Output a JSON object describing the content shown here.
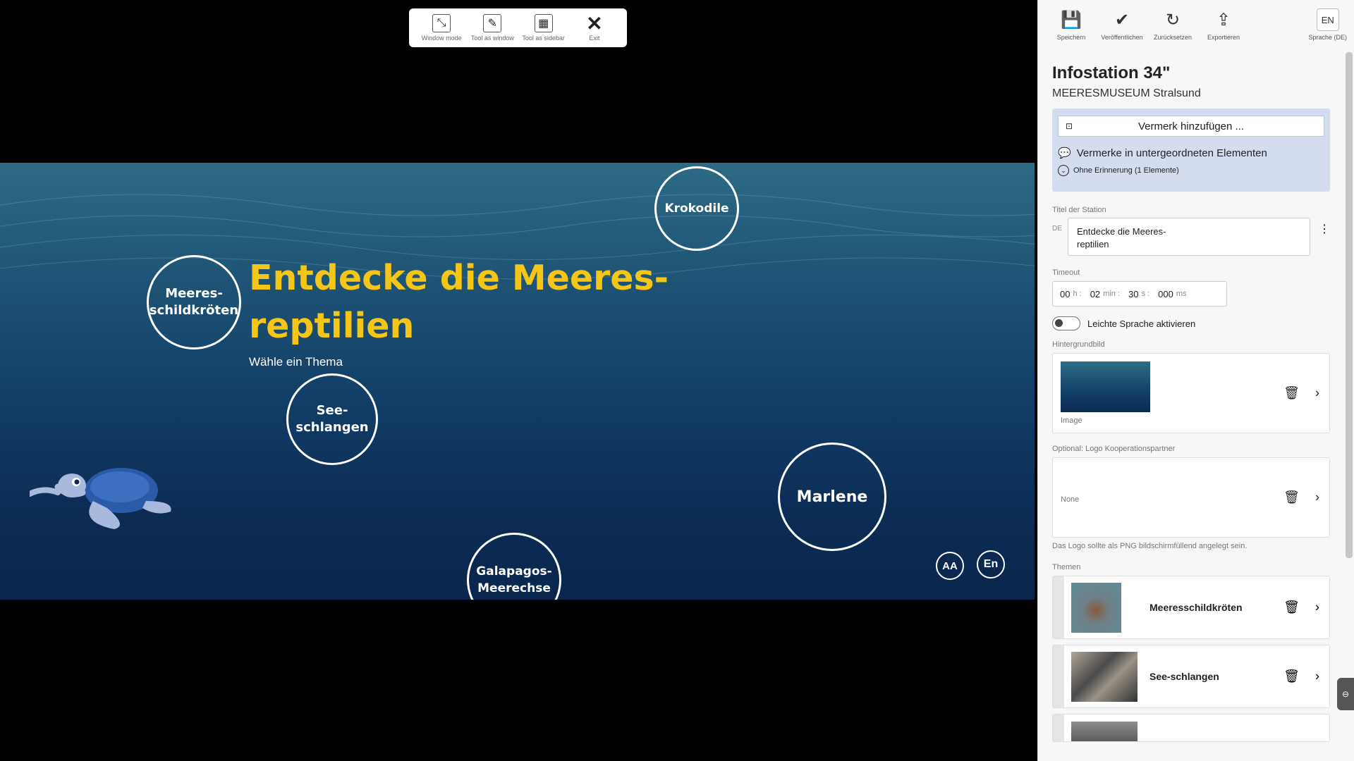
{
  "toolbar": {
    "window_mode": "Window mode",
    "tool_as_window": "Tool as window",
    "tool_as_sidebar": "Tool as sidebar",
    "exit": "Exit"
  },
  "preview": {
    "title_line1": "Entdecke die Meeres-",
    "title_line2": "reptilien",
    "subtitle": "Wähle ein Thema",
    "bubbles": {
      "krokodile": "Krokodile",
      "meeresschildkroeten_1": "Meeres-",
      "meeresschildkroeten_2": "schildkröten",
      "seeschlangen_1": "See-",
      "seeschlangen_2": "schlangen",
      "marlene": "Marlene",
      "galapagos_1": "Galapagos-",
      "galapagos_2": "Meerechse"
    },
    "font_size_button": "AA",
    "language_button": "En"
  },
  "panel": {
    "toolbar": {
      "save": "Speichern",
      "publish": "Veröffentlichen",
      "reset": "Zurücksetzen",
      "export": "Exportieren",
      "language_code": "EN",
      "language_label": "Sprache (DE)"
    },
    "station_title": "Infostation 34\"",
    "station_subtitle": "MEERESMUSEUM Stralsund",
    "notes": {
      "add": "Vermerk hinzufügen ...",
      "sub_elements": "Vermerke in untergeordneten Elementen",
      "no_reminder": "Ohne Erinnerung (1 Elemente)"
    },
    "title_label": "Titel der Station",
    "title_lang": "DE",
    "title_value_line1": "Entdecke die Meeres-",
    "title_value_line2": "reptilien",
    "timeout_label": "Timeout",
    "timeout": {
      "h": "00",
      "min": "02",
      "s": "30",
      "ms": "000",
      "u_h": "h :",
      "u_min": "min :",
      "u_s": "s :",
      "u_ms": "ms"
    },
    "light_language": "Leichte Sprache aktivieren",
    "background_label": "Hintergrundbild",
    "background_caption": "Image",
    "logo_label": "Optional: Logo Kooperationspartner",
    "logo_value": "None",
    "logo_hint": "Das Logo sollte als PNG bildschirmfüllend angelegt sein.",
    "themes_label": "Themen",
    "themes": [
      {
        "name": "Meeresschildkröten"
      },
      {
        "name": "See-schlangen"
      }
    ]
  }
}
